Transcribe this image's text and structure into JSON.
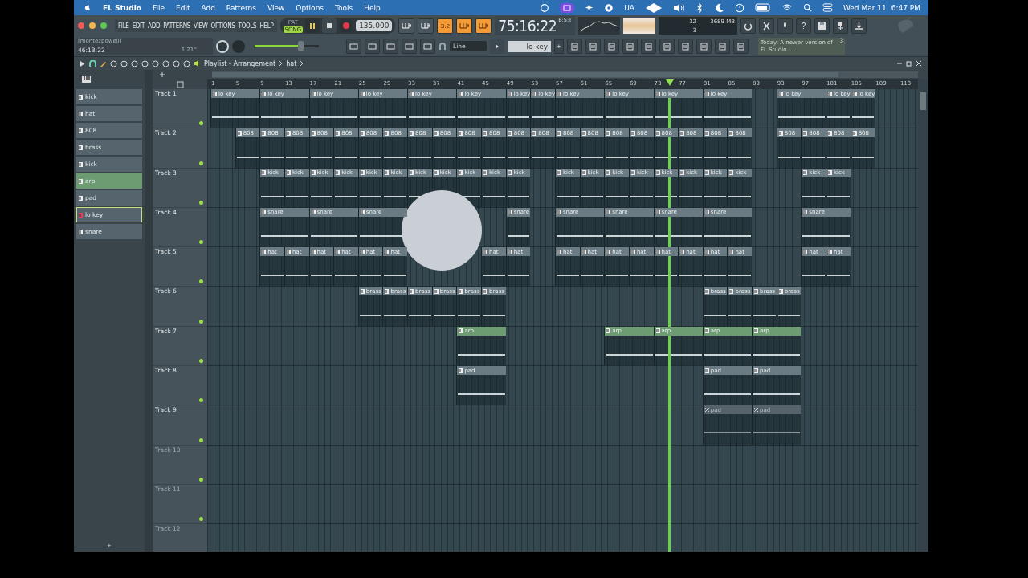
{
  "menubar": {
    "app": "FL Studio",
    "menus": [
      "File",
      "Edit",
      "Add",
      "Patterns",
      "View",
      "Options",
      "Tools",
      "Help"
    ],
    "status_text": "UA",
    "date": "Wed Mar 11",
    "time": "6:47 PM"
  },
  "toolbar": {
    "menus": [
      "FILE",
      "EDIT",
      "ADD",
      "PATTERNS",
      "VIEW",
      "OPTIONS",
      "TOOLS",
      "HELP"
    ],
    "modes": [
      {
        "label": "PAT",
        "selected": false
      },
      {
        "label": "SONG",
        "selected": true
      }
    ],
    "playing": true,
    "tempo": "135.000",
    "toggles": [
      {
        "kind": "icon",
        "on": false
      },
      {
        "kind": "icon",
        "on": false
      },
      {
        "kind": "text",
        "label": "3.2",
        "on": true
      },
      {
        "kind": "icon",
        "on": true
      },
      {
        "kind": "icon",
        "on": true
      }
    ],
    "song_time": "75:16:22",
    "time_unit": "B:S:T",
    "meters": [
      "32",
      "3689 MB",
      "3"
    ],
    "help_label": "?",
    "hint": {
      "user": "[montezpowell]",
      "time": "46:13:22",
      "duration": "1'21''"
    },
    "master_volume": {
      "level": 0.72
    },
    "snap": "Line",
    "pattern": "lo key",
    "add_label": "+",
    "news": {
      "text": "Today: A newer version of FL Studio i…",
      "badge": "3"
    }
  },
  "playlist": {
    "title": "Playlist - Arrangement",
    "path": [
      "hat"
    ],
    "patterns": [
      {
        "name": "kick",
        "color": "#56656d",
        "selected": false
      },
      {
        "name": "hat",
        "color": "#56656d",
        "selected": false
      },
      {
        "name": "808",
        "color": "#56656d",
        "selected": false
      },
      {
        "name": "brass",
        "color": "#56656d",
        "selected": false
      },
      {
        "name": "kick",
        "color": "#56656d",
        "selected": false
      },
      {
        "name": "arp",
        "color": "#6e9c72",
        "selected": false
      },
      {
        "name": "pad",
        "color": "#56656d",
        "selected": false
      },
      {
        "name": "lo key",
        "color": "#56656d",
        "selected": true
      },
      {
        "name": "snare",
        "color": "#56656d",
        "selected": false
      }
    ],
    "add_track": "+",
    "ruler": [
      "1",
      "5",
      "9",
      "13",
      "17",
      "21",
      "25",
      "29",
      "33",
      "37",
      "41",
      "45",
      "49",
      "53",
      "57",
      "61",
      "65",
      "69",
      "73",
      "77",
      "81",
      "85",
      "89",
      "93",
      "97",
      "101",
      "105",
      "109",
      "113"
    ],
    "tracks": [
      {
        "name": "Track 1",
        "dimmed": false,
        "clips": [
          {
            "label": "lo key",
            "color": "#6b7b83",
            "muted": false
          },
          {
            "label": "lo key",
            "color": "#6b7b83",
            "muted": false
          },
          {
            "label": "lo key",
            "color": "#6b7b83",
            "muted": false
          },
          {
            "label": "lo key",
            "color": "#6b7b83",
            "muted": false
          },
          {
            "label": "lo key",
            "color": "#6b7b83",
            "muted": false
          },
          {
            "label": "lo key",
            "color": "#6b7b83",
            "muted": false
          },
          {
            "label": "lo key",
            "color": "#6b7b83",
            "muted": false
          },
          {
            "label": "lo key",
            "color": "#6b7b83",
            "muted": false
          },
          {
            "label": "lo key",
            "color": "#6b7b83",
            "muted": false
          },
          {
            "label": "lo key",
            "color": "#6b7b83",
            "muted": false
          },
          {
            "label": "lo key",
            "color": "#6b7b83",
            "muted": false
          },
          {
            "label": "lo key",
            "color": "#6b7b83",
            "muted": false
          },
          {
            "label": "lo key",
            "color": "#6b7b83",
            "muted": false
          },
          {
            "label": "lo key",
            "color": "#6b7b83",
            "muted": false
          },
          {
            "label": "lo key",
            "color": "#6b7b83",
            "muted": false
          }
        ]
      },
      {
        "name": "Track 2",
        "dimmed": false,
        "clips": [
          {
            "label": "808",
            "color": "#6b7b83",
            "muted": false
          },
          {
            "label": "808",
            "color": "#6b7b83",
            "muted": false
          },
          {
            "label": "808",
            "color": "#6b7b83",
            "muted": false
          },
          {
            "label": "808",
            "color": "#6b7b83",
            "muted": false
          },
          {
            "label": "808",
            "color": "#6b7b83",
            "muted": false
          },
          {
            "label": "808",
            "color": "#6b7b83",
            "muted": false
          },
          {
            "label": "808",
            "color": "#6b7b83",
            "muted": false
          },
          {
            "label": "808",
            "color": "#6b7b83",
            "muted": false
          },
          {
            "label": "808",
            "color": "#6b7b83",
            "muted": false
          },
          {
            "label": "808",
            "color": "#6b7b83",
            "muted": false
          },
          {
            "label": "808",
            "color": "#6b7b83",
            "muted": false
          },
          {
            "label": "808",
            "color": "#6b7b83",
            "muted": false
          },
          {
            "label": "808",
            "color": "#6b7b83",
            "muted": false
          },
          {
            "label": "808",
            "color": "#6b7b83",
            "muted": false
          },
          {
            "label": "808",
            "color": "#6b7b83",
            "muted": false
          },
          {
            "label": "808",
            "color": "#6b7b83",
            "muted": false
          },
          {
            "label": "808",
            "color": "#6b7b83",
            "muted": false
          },
          {
            "label": "808",
            "color": "#6b7b83",
            "muted": false
          },
          {
            "label": "808",
            "color": "#6b7b83",
            "muted": false
          },
          {
            "label": "808",
            "color": "#6b7b83",
            "muted": false
          },
          {
            "label": "808",
            "color": "#6b7b83",
            "muted": false
          },
          {
            "label": "808",
            "color": "#6b7b83",
            "muted": false
          },
          {
            "label": "808",
            "color": "#6b7b83",
            "muted": false
          },
          {
            "label": "808",
            "color": "#6b7b83",
            "muted": false
          },
          {
            "label": "808",
            "color": "#6b7b83",
            "muted": false
          }
        ]
      },
      {
        "name": "Track 3",
        "dimmed": false,
        "clips": [
          {
            "label": "kick",
            "color": "#6b7b83",
            "muted": false
          },
          {
            "label": "kick",
            "color": "#6b7b83",
            "muted": false
          },
          {
            "label": "kick",
            "color": "#6b7b83",
            "muted": false
          },
          {
            "label": "kick",
            "color": "#6b7b83",
            "muted": false
          },
          {
            "label": "kick",
            "color": "#6b7b83",
            "muted": false
          },
          {
            "label": "kick",
            "color": "#6b7b83",
            "muted": false
          },
          {
            "label": "kick",
            "color": "#6b7b83",
            "muted": false
          },
          {
            "label": "kick",
            "color": "#6b7b83",
            "muted": false
          },
          {
            "label": "kick",
            "color": "#6b7b83",
            "muted": false
          },
          {
            "label": "kick",
            "color": "#6b7b83",
            "muted": false
          },
          {
            "label": "kick",
            "color": "#6b7b83",
            "muted": false
          },
          {
            "label": "kick",
            "color": "#6b7b83",
            "muted": false
          },
          {
            "label": "kick",
            "color": "#6b7b83",
            "muted": false
          },
          {
            "label": "kick",
            "color": "#6b7b83",
            "muted": false
          },
          {
            "label": "kick",
            "color": "#6b7b83",
            "muted": false
          },
          {
            "label": "kick",
            "color": "#6b7b83",
            "muted": false
          },
          {
            "label": "kick",
            "color": "#6b7b83",
            "muted": false
          },
          {
            "label": "kick",
            "color": "#6b7b83",
            "muted": false
          },
          {
            "label": "kick",
            "color": "#6b7b83",
            "muted": false
          },
          {
            "label": "kick",
            "color": "#6b7b83",
            "muted": false
          },
          {
            "label": "kick",
            "color": "#6b7b83",
            "muted": false
          }
        ]
      },
      {
        "name": "Track 4",
        "dimmed": false,
        "clips": [
          {
            "label": "snare",
            "color": "#6b7b83",
            "muted": false
          },
          {
            "label": "snare",
            "color": "#6b7b83",
            "muted": false
          },
          {
            "label": "snare",
            "color": "#6b7b83",
            "muted": false
          },
          {
            "label": "snare",
            "color": "#6b7b83",
            "muted": false
          },
          {
            "label": "snare",
            "color": "#6b7b83",
            "muted": false
          },
          {
            "label": "snare",
            "color": "#6b7b83",
            "muted": false
          },
          {
            "label": "snare",
            "color": "#6b7b83",
            "muted": false
          },
          {
            "label": "snare",
            "color": "#6b7b83",
            "muted": false
          },
          {
            "label": "snare",
            "color": "#6b7b83",
            "muted": false
          }
        ]
      },
      {
        "name": "Track 5",
        "dimmed": false,
        "clips": [
          {
            "label": "hat",
            "color": "#6b7b83",
            "muted": false
          },
          {
            "label": "hat",
            "color": "#6b7b83",
            "muted": false
          },
          {
            "label": "hat",
            "color": "#6b7b83",
            "muted": false
          },
          {
            "label": "hat",
            "color": "#6b7b83",
            "muted": false
          },
          {
            "label": "hat",
            "color": "#6b7b83",
            "muted": false
          },
          {
            "label": "hat",
            "color": "#6b7b83",
            "muted": false
          },
          {
            "label": "hat",
            "color": "#6b7b83",
            "muted": false
          },
          {
            "label": "hat",
            "color": "#6b7b83",
            "muted": false
          },
          {
            "label": "hat",
            "color": "#6b7b83",
            "muted": false
          },
          {
            "label": "hat",
            "color": "#6b7b83",
            "muted": false
          },
          {
            "label": "hat",
            "color": "#6b7b83",
            "muted": false
          },
          {
            "label": "hat",
            "color": "#6b7b83",
            "muted": false
          },
          {
            "label": "hat",
            "color": "#6b7b83",
            "muted": false
          },
          {
            "label": "hat",
            "color": "#6b7b83",
            "muted": false
          },
          {
            "label": "hat",
            "color": "#6b7b83",
            "muted": false
          },
          {
            "label": "hat",
            "color": "#6b7b83",
            "muted": false
          },
          {
            "label": "hat",
            "color": "#6b7b83",
            "muted": false
          },
          {
            "label": "hat",
            "color": "#6b7b83",
            "muted": false
          }
        ]
      },
      {
        "name": "Track 6",
        "dimmed": false,
        "clips": [
          {
            "label": "brass",
            "color": "#6b7b83",
            "muted": false
          },
          {
            "label": "brass",
            "color": "#6b7b83",
            "muted": false
          },
          {
            "label": "brass",
            "color": "#6b7b83",
            "muted": false
          },
          {
            "label": "brass",
            "color": "#6b7b83",
            "muted": false
          },
          {
            "label": "brass",
            "color": "#6b7b83",
            "muted": false
          },
          {
            "label": "brass",
            "color": "#6b7b83",
            "muted": false
          },
          {
            "label": "brass",
            "color": "#6b7b83",
            "muted": false
          },
          {
            "label": "brass",
            "color": "#6b7b83",
            "muted": false
          },
          {
            "label": "brass",
            "color": "#6b7b83",
            "muted": false
          },
          {
            "label": "brass",
            "color": "#6b7b83",
            "muted": false
          }
        ]
      },
      {
        "name": "Track 7",
        "dimmed": false,
        "clips": [
          {
            "label": "arp",
            "color": "#6e9c72",
            "muted": false
          },
          {
            "label": "arp",
            "color": "#6e9c72",
            "muted": false
          },
          {
            "label": "arp",
            "color": "#6e9c72",
            "muted": false
          },
          {
            "label": "arp",
            "color": "#6e9c72",
            "muted": false
          },
          {
            "label": "arp",
            "color": "#6e9c72",
            "muted": false
          }
        ]
      },
      {
        "name": "Track 8",
        "dimmed": false,
        "clips": [
          {
            "label": "pad",
            "color": "#6b7b83",
            "muted": false
          },
          {
            "label": "pad",
            "color": "#6b7b83",
            "muted": false
          },
          {
            "label": "pad",
            "color": "#6b7b83",
            "muted": false
          }
        ]
      },
      {
        "name": "Track 9",
        "dimmed": false,
        "clips": [
          {
            "label": "pad",
            "color": "#56636a",
            "muted": true
          },
          {
            "label": "pad",
            "color": "#56636a",
            "muted": true
          }
        ]
      },
      {
        "name": "Track 10",
        "dimmed": true
      },
      {
        "name": "Track 11",
        "dimmed": true
      },
      {
        "name": "Track 12",
        "dimmed": true
      }
    ]
  }
}
